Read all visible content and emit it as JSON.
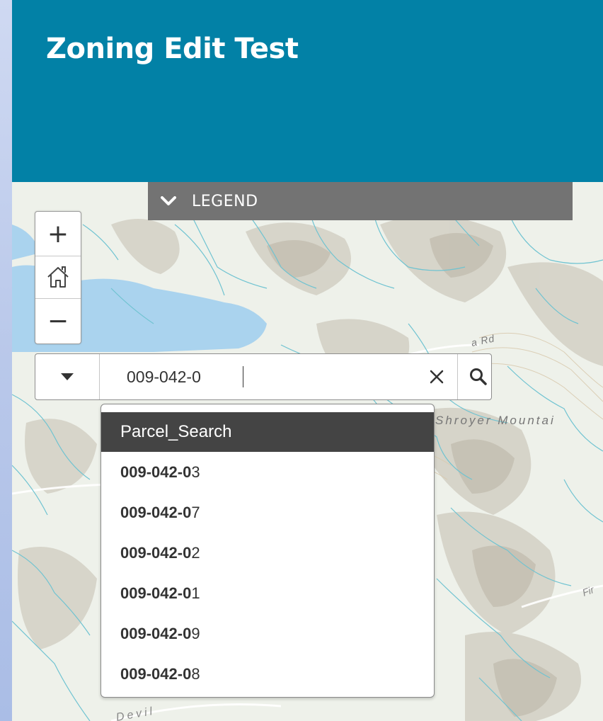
{
  "header": {
    "title": "Zoning Edit Test"
  },
  "legend": {
    "label": "LEGEND"
  },
  "map_controls": {
    "zoom_in": "+",
    "zoom_out": "−"
  },
  "map_labels": {
    "road": "a Rd",
    "mountain": "Shroyer Mountai",
    "road2": "Fir",
    "place": "Devil"
  },
  "search": {
    "value": "009-042-0",
    "source_group": "Parcel_Search",
    "suggestions": [
      {
        "match": "009-042-0",
        "rest": "3"
      },
      {
        "match": "009-042-0",
        "rest": "7"
      },
      {
        "match": "009-042-0",
        "rest": "2"
      },
      {
        "match": "009-042-0",
        "rest": "1"
      },
      {
        "match": "009-042-0",
        "rest": "9"
      },
      {
        "match": "009-042-0",
        "rest": "8"
      }
    ]
  },
  "colors": {
    "header_bg": "#0281a6",
    "legend_bg": "#737373",
    "group_bg": "#444444",
    "water": "#aad3ee",
    "stream": "#6fc3d1"
  },
  "icons": [
    "chevron-down-icon",
    "plus-icon",
    "home-icon",
    "minus-icon",
    "caret-down-icon",
    "close-icon",
    "search-icon"
  ]
}
